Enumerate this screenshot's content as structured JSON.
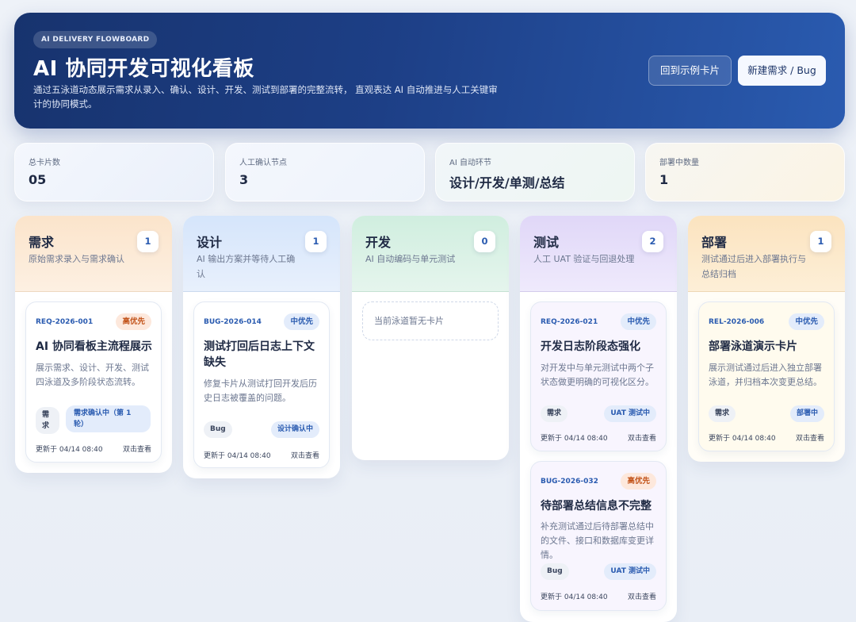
{
  "header": {
    "tag": "AI DELIVERY FLOWBOARD",
    "title": "AI 协同开发可视化看板",
    "description": "通过五泳道动态展示需求从录入、确认、设计、开发、测试到部署的完整流转， 直观表达 AI 自动推进与人工关键审计的协同模式。",
    "back_button": "回到示例卡片",
    "new_button": "新建需求 / Bug"
  },
  "stats": [
    {
      "label": "总卡片数",
      "value": "05"
    },
    {
      "label": "人工确认节点",
      "value": "3"
    },
    {
      "label": "AI 自动环节",
      "value": "设计/开发/单测/总结"
    },
    {
      "label": "部署中数量",
      "value": "1"
    }
  ],
  "columns": [
    {
      "title": "需求",
      "desc": "原始需求录入与需求确认",
      "count": "1",
      "head_color": "#fbe6cf",
      "cards": [
        {
          "id": "REQ-2026-001",
          "priority": "高优先",
          "title": "AI 协同看板主流程展示",
          "desc": "展示需求、设计、开发、测试四泳道及多阶段状态流转。",
          "tag1": "需求",
          "tag2": "需求确认中（第 1 轮）",
          "time": "更新于 04/14 08:40",
          "open": "双击查看"
        }
      ]
    },
    {
      "title": "设计",
      "desc": "AI 输出方案并等待人工确认",
      "count": "1",
      "head_color": "#d9e8fb",
      "cards": [
        {
          "id": "BUG-2026-014",
          "priority": "中优先",
          "title": "测试打回后日志上下文缺失",
          "desc": "修复卡片从测试打回开发后历史日志被覆盖的问题。",
          "tag1": "Bug",
          "tag2": "设计确认中",
          "time": "更新于 04/14 08:40",
          "open": "双击查看"
        }
      ]
    },
    {
      "title": "开发",
      "desc": "AI 自动编码与单元测试",
      "count": "0",
      "head_color": "#d4efe2",
      "empty": "当前泳道暂无卡片",
      "cards": []
    },
    {
      "title": "测试",
      "desc": "人工 UAT 验证与回退处理",
      "count": "2",
      "head_color": "#e3dcf8",
      "cards": [
        {
          "id": "REQ-2026-021",
          "priority": "中优先",
          "title": "开发日志阶段态强化",
          "desc": "对开发中与单元测试中两个子状态做更明确的可视化区分。",
          "tag1": "需求",
          "tag2": "UAT 测试中",
          "time": "更新于 04/14 08:40",
          "open": "双击查看"
        },
        {
          "id": "BUG-2026-032",
          "priority": "高优先",
          "title": "待部署总结信息不完整",
          "desc": "补充测试通过后待部署总结中的文件、接口和数据库变更详情。",
          "tag1": "Bug",
          "tag2": "UAT 测试中",
          "time": "更新于 04/14 08:40",
          "open": "双击查看"
        }
      ]
    },
    {
      "title": "部署",
      "desc": "测试通过后进入部署执行与总结归档",
      "count": "1",
      "head_color": "#fbe6c4",
      "cards": [
        {
          "id": "REL-2026-006",
          "priority": "中优先",
          "title": "部署泳道演示卡片",
          "desc": "展示测试通过后进入独立部署泳道，并归档本次变更总结。",
          "tag1": "需求",
          "tag2": "部署中",
          "time": "更新于 04/14 08:40",
          "open": "双击查看"
        }
      ]
    }
  ]
}
